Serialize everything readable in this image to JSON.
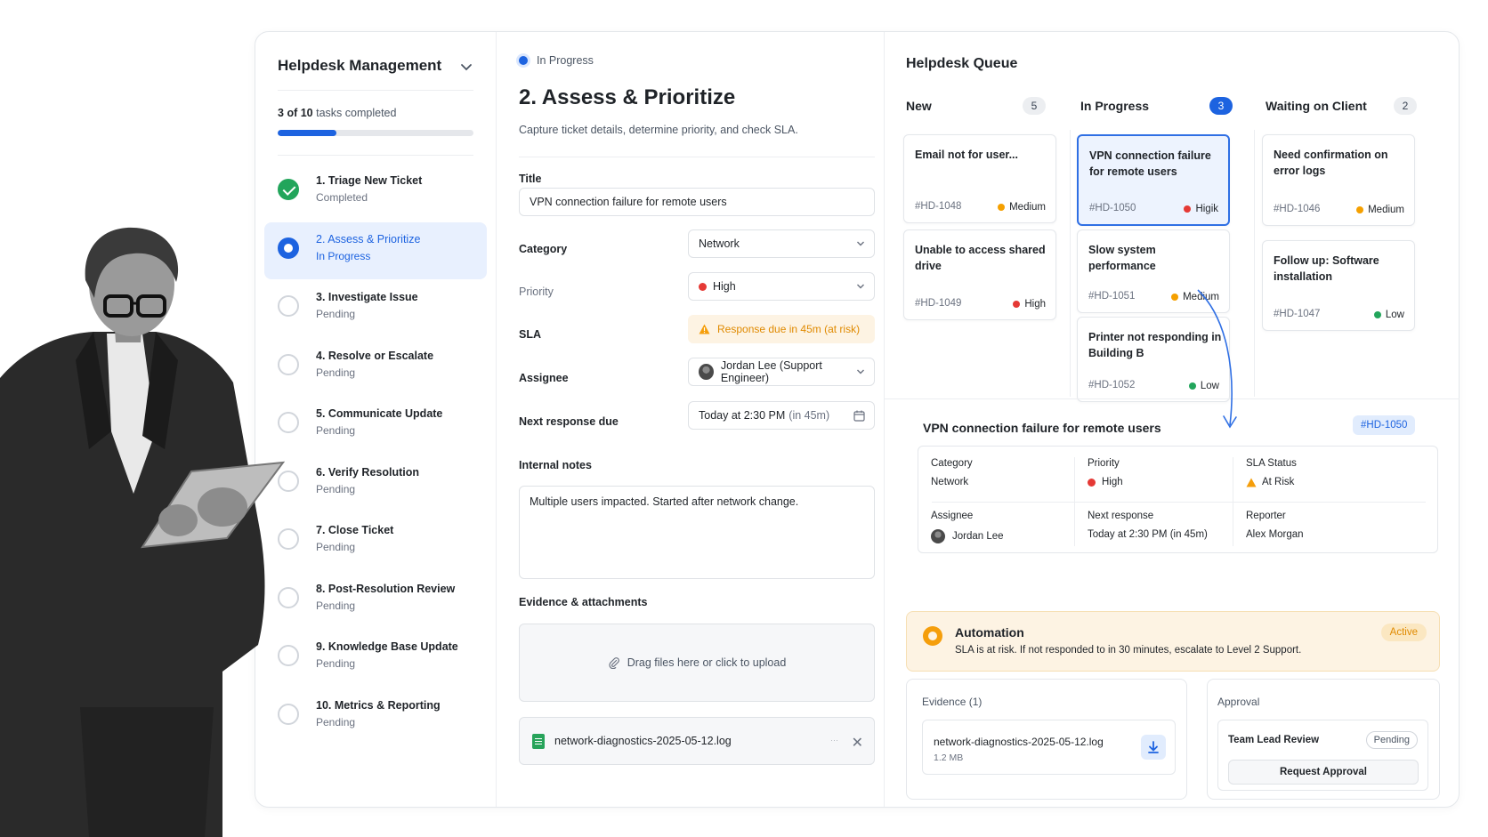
{
  "sidebar": {
    "project_title": "Helpdesk Management",
    "progress_completed": "3",
    "progress_of": "of",
    "progress_total": "10",
    "progress_suffix": "tasks completed",
    "progress_fraction": 0.3,
    "steps": [
      {
        "name": "1. Triage New Ticket",
        "status": "Completed",
        "state": "done"
      },
      {
        "name": "2. Assess & Prioritize",
        "status": "In Progress",
        "state": "current"
      },
      {
        "name": "3. Investigate Issue",
        "status": "Pending",
        "state": "pending"
      },
      {
        "name": "4. Resolve or Escalate",
        "status": "Pending",
        "state": "pending"
      },
      {
        "name": "5. Communicate Update",
        "status": "Pending",
        "state": "pending"
      },
      {
        "name": "6. Verify Resolution",
        "status": "Pending",
        "state": "pending"
      },
      {
        "name": "7. Close Ticket",
        "status": "Pending",
        "state": "pending"
      },
      {
        "name": "8. Post-Resolution Review",
        "status": "Pending",
        "state": "pending"
      },
      {
        "name": "9. Knowledge Base Update",
        "status": "Pending",
        "state": "pending"
      },
      {
        "name": "10. Metrics & Reporting",
        "status": "Pending",
        "state": "pending"
      }
    ]
  },
  "form": {
    "stage_badge": "In Progress",
    "title": "2. Assess & Prioritize",
    "description": "Capture ticket details, determine priority, and check SLA.",
    "fields": {
      "title_label": "Title",
      "title_value": "VPN connection failure for remote users",
      "category_label": "Category",
      "category_value": "Network",
      "priority_label": "Priority",
      "priority_value": "High",
      "sla_label": "SLA",
      "sla_value": "Response due in 45m (at risk)",
      "assignee_label": "Assignee",
      "assignee_value": "Jordan Lee (Support Engineer)",
      "next_response_label": "Next response due",
      "next_response_value": "Today at 2:30 PM",
      "next_response_hint": "(in 45m)",
      "notes_label": "Internal notes",
      "notes_value": "Multiple users impacted. Started after network change.",
      "evidence_label": "Evidence & attachments",
      "dropzone_text": "Drag files here or click to upload",
      "attached_file": "network-diagnostics-2025-05-12.log"
    }
  },
  "queue": {
    "title": "Helpdesk Queue",
    "columns": [
      {
        "name": "New",
        "count": "5"
      },
      {
        "name": "In Progress",
        "count": "3"
      },
      {
        "name": "Waiting on Client",
        "count": "2"
      }
    ],
    "tickets": [
      {
        "title": "Email not for user...",
        "id": "#HD-1048",
        "priority": "Medium"
      },
      {
        "title": "Unable to access shared drive",
        "id": "#HD-1049",
        "priority": "High"
      },
      {
        "title": "VPN connection failure for remote users",
        "id": "#HD-1050",
        "priority": "Higik"
      },
      {
        "title": "Slow system performance",
        "id": "#HD-1051",
        "priority": "Medium"
      },
      {
        "title": "Printer not responding in Building B",
        "id": "#HD-1052",
        "priority": "Low"
      },
      {
        "title": "Need confirmation on error logs",
        "id": "#HD-1046",
        "priority": "Medium"
      },
      {
        "title": "Follow up: Software installation",
        "id": "#HD-1047",
        "priority": "Low"
      }
    ]
  },
  "detail": {
    "title": "VPN connection failure for remote users",
    "id": "#HD-1050",
    "category_label": "Category",
    "category_value": "Network",
    "priority_label": "Priority",
    "priority_value": "High",
    "sla_label": "SLA Status",
    "sla_value": "At Risk",
    "assignee_label": "Assignee",
    "assignee_value": "Jordan Lee",
    "next_label": "Next response",
    "next_value": "Today at 2:30 PM (in 45m)",
    "reporter_label": "Reporter",
    "reporter_value": "Alex Morgan"
  },
  "automation": {
    "title": "Automation",
    "text": "SLA is at risk. If not responded to in 30 minutes, escalate to Level 2 Support.",
    "badge": "Active"
  },
  "evidence": {
    "label": "Evidence (1)",
    "file_name": "network-diagnostics-2025-05-12.log",
    "file_size": "1.2 MB"
  },
  "approval": {
    "label": "Approval",
    "name": "Team Lead Review",
    "status": "Pending",
    "button": "Request Approval"
  },
  "colors": {
    "accent": "#1d63e0",
    "high": "#e53935",
    "medium": "#f5a000",
    "low": "#22a55b",
    "done": "#22a55b",
    "warning_bg": "#fdf3e3"
  }
}
